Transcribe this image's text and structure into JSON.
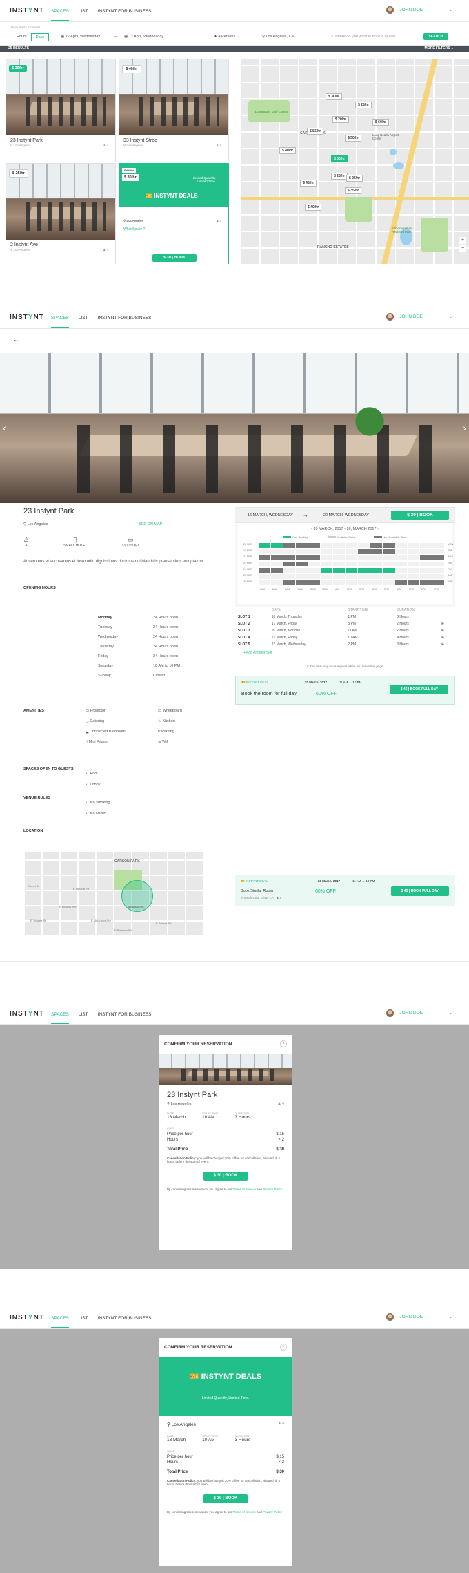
{
  "brand": {
    "logo_a": "INST",
    "logo_b": "Y",
    "logo_c": "NT"
  },
  "nav": {
    "spaces": "SPACES",
    "list": "LIST",
    "business": "INSTYNT FOR BUSINESS",
    "user": "JOHN DOE"
  },
  "filter": {
    "hint": "Book hours for renter",
    "hours": "Hours",
    "days": "Days",
    "start": "12 April, Wednesday",
    "end": "12 April, Wednesday",
    "persons": "4 Persons",
    "location": "Los Angeles, CA",
    "search_placeholder": "Where do you want to book a space...",
    "search_btn": "SEARCH"
  },
  "results": {
    "count": "25 RESULTS",
    "more": "MORE FILTERS"
  },
  "cards": [
    {
      "price": "$ 30/hr",
      "title": "23 Instynt Park",
      "loc": "Los Angeles",
      "cap": "4"
    },
    {
      "price": "$ 40/hr",
      "title": "33 Instynt Stree",
      "loc": "Los Angeles",
      "cap": "8"
    },
    {
      "price": "$ 25/hr",
      "title": "2 Instynt Ave",
      "loc": "Los Angeles",
      "cap": "4"
    }
  ],
  "deal_card": {
    "old": "$ 50/hr",
    "price": "$ 30/hr",
    "limited": "Limited Quantity.",
    "limited2": "Limited Time.",
    "title": "INSTYNT DEALS",
    "loc": "Los Angeles",
    "cap": "5",
    "what": "What Space ?",
    "btn": "$ 30 |  BOOK"
  },
  "map": {
    "pins": [
      "$ 30/hr",
      "$ 25/hr",
      "$ 20/hr",
      "$ 60/hr",
      "$ 55/hr",
      "$ 50/hr",
      "$ 40/hr",
      "$ 30/hr",
      "$ 25/hr",
      "$ 45/hr",
      "$ 25/hr",
      "$ 35/hr",
      "$ 40/hr"
    ],
    "labels": {
      "golf": "Dominguez Golf Course",
      "carson": "CARSON PARK",
      "airport": "Long Beach Airport Center",
      "rancho": "RANCHO ESTATES",
      "eldorado": "El Dorado East Regional Park"
    }
  },
  "detail": {
    "title": "23 Instynt Park",
    "loc": "Los Angeles",
    "see_map": "SEE ON MAP",
    "cap": "4",
    "type": "SMALL HOTEL",
    "size": "1300 SQFT",
    "desc": "At vero eos et accusamus et iusto odio dignissimos ducimus qui blanditiis praesentium voluptatum",
    "hours_label": "OPENING HOURS",
    "hours": [
      {
        "d": "Monday",
        "h": "24 Hours open"
      },
      {
        "d": "Tuesday",
        "h": "24 Hours open"
      },
      {
        "d": "Wednesday",
        "h": "24 Hours open"
      },
      {
        "d": "Thursday",
        "h": "24 Hours open"
      },
      {
        "d": "Friday",
        "h": "24 Hours open"
      },
      {
        "d": "Saturday",
        "h": "10 AM to 10 PM"
      },
      {
        "d": "Sunday",
        "h": "Closed"
      }
    ],
    "amen_label": "AMENITIES",
    "amenities": [
      "Projector",
      "Whiteboard",
      "Catering",
      "Kitchen",
      "Connected Bathroom",
      "Parking",
      "Mini Fridge",
      "Wifi"
    ],
    "open_label": "SPACES OPEN TO GUESTS",
    "open": [
      "Pool",
      "Lobby"
    ],
    "rules_label": "VENUE RULES",
    "rules": [
      "No smoking",
      "No Music"
    ],
    "location_label": "LOCATION",
    "map_park": "CARSON PARK",
    "map_marker": "5 Monaco St",
    "streets": [
      "Comet St",
      "E Norada Ave",
      "E Tollgate St",
      "E Mcfarlane Ave",
      "E Brandon Rd",
      "E Norada Rd",
      "E Sunset Rd"
    ]
  },
  "booking": {
    "from": "16 MARCH, WEDNESDAY",
    "to": "20 MARCH, WEDNESDAY",
    "btn": "$ 30 |  BOOK",
    "range": "20 MARCH, 2017  -  26, MARCH 2017",
    "legend": [
      "Your Booking",
      "Available Slots",
      "Non Available Slots"
    ],
    "days": [
      "20 MAR",
      "21 MAR",
      "22 MAR",
      "23 MAR",
      "24 MAR",
      "25 MAR",
      "26 MAR"
    ],
    "dow": [
      "MON",
      "TUE",
      "WED",
      "THU",
      "FRI",
      "SAT",
      "SUN"
    ],
    "times": [
      "7AM",
      "8AM",
      "9AM",
      "10AM",
      "11AM",
      "12PM",
      "1PM",
      "2PM",
      "3PM",
      "4PM",
      "5PM",
      "6PM",
      "7PM",
      "8PM",
      "9PM"
    ],
    "cols": [
      "DATE",
      "START TIME",
      "DURATION"
    ],
    "slots": [
      {
        "s": "SLOT 1",
        "d": "16 March, Thursday",
        "t": "1 PM",
        "u": "3 Hours"
      },
      {
        "s": "SLOT 2",
        "d": "17 March, Friday",
        "t": "5 PM",
        "u": "2 Hours"
      },
      {
        "s": "SLOT 3",
        "d": "20 March, Monday",
        "t": "11 AM",
        "u": "2 Hours"
      },
      {
        "s": "SLOT 4",
        "d": "21 March, Friday",
        "t": "10 AM",
        "u": "4 Hours"
      },
      {
        "s": "SLOT 5",
        "d": "23 March, Wednesday",
        "t": "2 PM",
        "u": "3 Hours"
      }
    ],
    "add": "+ Add Another Slot",
    "expired": "The deal may have expired when you leave this page."
  },
  "deal1": {
    "tag": "INSTYNT DEAL",
    "date": "20 March, 2017",
    "time": "11 AM  →  10 PM",
    "title": "Book the room for full day",
    "off": "60% OFF",
    "btn": "$ 45 |  BOOK FULL DAY"
  },
  "deal2": {
    "tag": "INSTYNT DEAL",
    "date": "20 March, 2017",
    "time": "11 AM  →  10 PM",
    "title": "Book Similar Room",
    "loc": "South Lake Drive, CA",
    "cap": "5",
    "off": "60% OFF",
    "btn": "$ 45 |  BOOK FULL DAY"
  },
  "modal": {
    "header": "CONFIRM YOUR RESERVATION",
    "title": "23 Instynt Park",
    "loc": "Los Angeles",
    "cap": "4",
    "date_l": "DATE",
    "date": "13 March",
    "start_l": "START TIME",
    "start": "10 AM",
    "dur_l": "DURATION",
    "dur": "3 Hours",
    "cost_l": "COST",
    "ppH_l": "Price per hour",
    "ppH": "$ 15",
    "hours_l": "Hours",
    "hours": "× 2",
    "total_l": "Total Price",
    "total": "$ 30",
    "policy_b": "Cancellation Policy:",
    "policy": "you will be charged 30% of fee for cancellation, allowed till 4 hours before the start of event.",
    "btn": "$ 30 |  BOOK",
    "foot_a": "By confirming this reservation, you agree to our ",
    "terms": "Terms of Service",
    "and": " and ",
    "privacy": "Privacy Policy",
    "deal_title": "INSTYNT DEALS",
    "deal_sub": "Limited Quantity, Limited Time."
  }
}
